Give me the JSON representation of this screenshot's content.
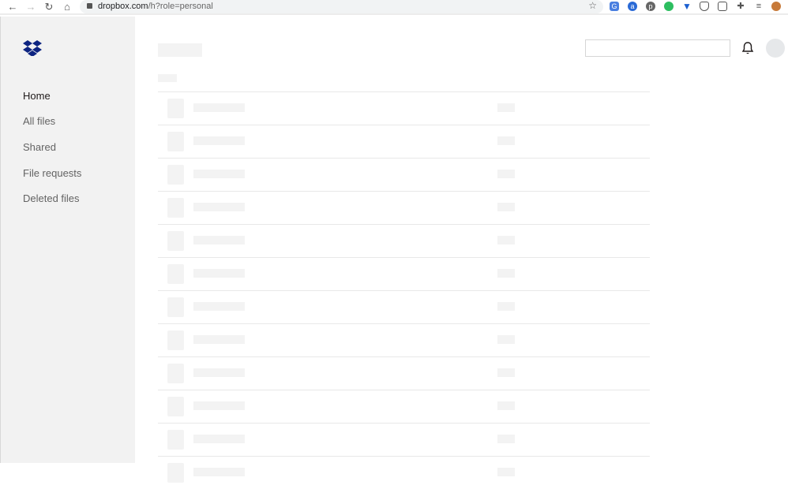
{
  "browser": {
    "url_host": "dropbox.com",
    "url_path": "/h?role=personal"
  },
  "sidebar": {
    "items": [
      {
        "label": "Home",
        "active": true
      },
      {
        "label": "All files"
      },
      {
        "label": "Shared"
      },
      {
        "label": "File requests"
      },
      {
        "label": "Deleted files"
      }
    ]
  },
  "colors": {
    "brand": "#0d2481",
    "sidebar_bg": "#f2f2f2",
    "skeleton": "#f3f3f3"
  }
}
